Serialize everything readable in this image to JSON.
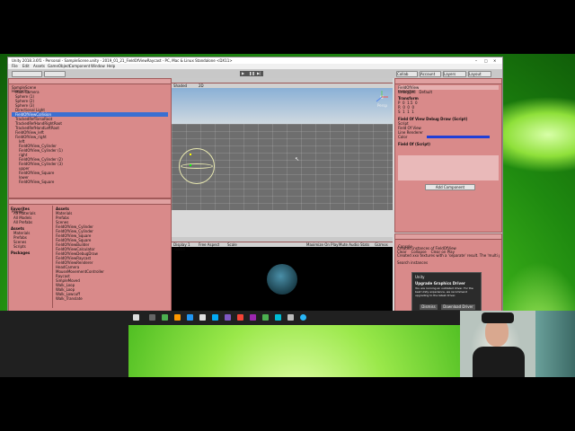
{
  "window": {
    "title": "Unity 2018.3.6f1 - Personal - SampleScene.unity - 2019_01_21_FieldOfViewRaycast - PC, Mac & Linux Standalone <DX11>",
    "menu": [
      "File",
      "Edit",
      "Assets",
      "GameObject",
      "Component",
      "Window",
      "Help"
    ],
    "toolbar_right": [
      "Collab",
      "Account",
      "Layers",
      "Layout"
    ]
  },
  "hierarchy": {
    "tab": "Hierarchy",
    "items": [
      "SampleScene",
      "Main Camera",
      "Sphere (1)",
      "Sphere (2)",
      "Sphere (3)",
      "Directional Light",
      "FieldOfViewCollision",
      "TrackedRefTorsoRoot",
      "TrackedRefHandRightRoot",
      "TrackedRefHandLeftRoot",
      "FieldOfView_left",
      "FieldOfView_right",
      "left",
      "FieldOfView_Cylinder",
      "FieldOfView_Cylinder (1)",
      "right",
      "FieldOfView_Cylinder (2)",
      "FieldOfView_Cylinder (3)",
      "upper",
      "FieldOfView_Square",
      "lower",
      "FieldOfView_Square"
    ]
  },
  "scene": {
    "tab": "Scene",
    "tab2": "Asset Store",
    "shading": "Shaded",
    "mode": "2D",
    "persp": "Persp"
  },
  "game": {
    "tab": "Game",
    "display": "Display 1",
    "aspect": "Free Aspect",
    "scale": "Scale",
    "buttons": [
      "Maximize On Play",
      "Mute Audio",
      "Stats",
      "Gizmos"
    ]
  },
  "project": {
    "tab": "Project",
    "favorites_label": "Favorites",
    "favorites": [
      "All Materials",
      "All Models",
      "All Prefabs"
    ],
    "assets_label": "Assets",
    "asset_tree": [
      "Materials",
      "Prefabs",
      "Scenes",
      "Scripts"
    ],
    "packages_label": "Packages",
    "files": [
      "Materials",
      "Prefabs",
      "Scenes",
      "FieldOfView_Cylinder",
      "FieldOfView_Cylinder",
      "FieldOfView_Square",
      "FieldOfView_Square",
      "FieldOfViewBuilder",
      "FieldOfViewCalculator",
      "FieldOfViewDebugDraw",
      "FieldOfViewRaycast",
      "FieldOfViewRenderer",
      "HeadCamera",
      "MouseMovementController",
      "Raycast",
      "SimpleMoved",
      "Walk_Loop",
      "Walk_Loop",
      "Walk_Lowcuff",
      "Walk_Translate"
    ]
  },
  "inspector": {
    "tab": "Inspector",
    "object_name": "FieldOfView",
    "tag": "Untagged",
    "layer": "Default",
    "transform_label": "Transform",
    "position": {
      "x": "0",
      "y": "1.5",
      "z": "0"
    },
    "rotation": {
      "x": "0",
      "y": "0",
      "z": "0"
    },
    "scale": {
      "x": "1",
      "y": "1",
      "z": "1"
    },
    "script_section": "Field Of View Debug Draw (Script)",
    "fields": [
      "Script",
      "Field Of View",
      "Line Renderer",
      "Color"
    ],
    "script2_section": "Field Of (Script)",
    "add_component": "Add Component"
  },
  "console": {
    "tab": "Console",
    "toolbar": [
      "Clear",
      "Collapse",
      "Clear on Play",
      "Error Pause",
      "Editor"
    ],
    "lines": [
      "Created instances of FieldOfView",
      "Created xxx textures with a 'separate' result. The 'multi pass' option...",
      "Search instances"
    ]
  },
  "dialog": {
    "header": "Unity",
    "title": "Upgrade Graphics Driver",
    "body": "You are running an outdated driver. For the best Unity experience, we recommend upgrading to the latest driver.",
    "buttons": [
      "Dismiss",
      "Download Driver"
    ]
  },
  "colors": {
    "unity_pink": "#d98a8a",
    "green_swirl": "#3fb51a",
    "taskbar": "#202020"
  }
}
